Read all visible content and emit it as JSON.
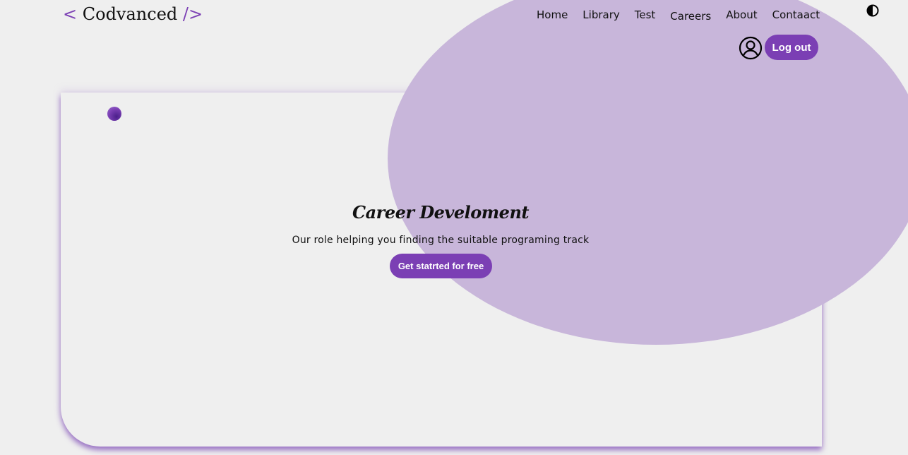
{
  "header": {
    "logo": {
      "open_bracket": "<",
      "name": "Codvanced",
      "close_bracket": "/>"
    },
    "nav": [
      {
        "label": "Home"
      },
      {
        "label": "Library"
      },
      {
        "label": "Test"
      },
      {
        "label": "Careers"
      },
      {
        "label": "About"
      },
      {
        "label": "Contaact"
      }
    ],
    "theme_toggle_icon": "contrast-icon",
    "user_icon": "user-circle-icon",
    "logout_label": "Log out"
  },
  "hero": {
    "title": "Career Develoment",
    "subtitle": "Our role helping you finding the suitable programing track",
    "cta_label": "Get statrted for free"
  },
  "colors": {
    "accent": "#7b3fb4",
    "blob": "#c8b6da",
    "background": "#efefef",
    "text": "#111111",
    "button_text": "#ffffff"
  }
}
